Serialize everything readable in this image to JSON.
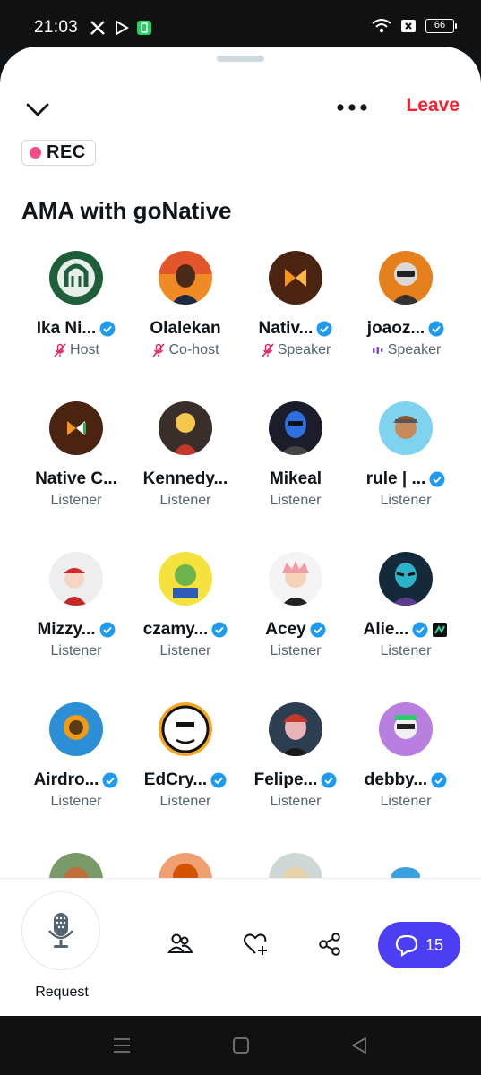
{
  "status_bar": {
    "time": "21:03",
    "battery": "66"
  },
  "header": {
    "leave_label": "Leave",
    "rec_label": "REC",
    "title": "AMA with goNative"
  },
  "colors": {
    "verified": "#1d9bf0",
    "leave": "#f4212e",
    "muted_role": "#e0245e",
    "accent": "#4b3ef3",
    "speaking": "#794bc4"
  },
  "participants": [
    {
      "name": "Ika Ni...",
      "role": "Host",
      "verified": true,
      "role_icon": "mic-off-icon"
    },
    {
      "name": "Olalekan",
      "role": "Co-host",
      "verified": false,
      "role_icon": "mic-off-icon"
    },
    {
      "name": "Nativ...",
      "role": "Speaker",
      "verified": true,
      "role_icon": "mic-off-icon"
    },
    {
      "name": "joaoz...",
      "role": "Speaker",
      "verified": true,
      "role_icon": "speaking-bars-icon"
    },
    {
      "name": "Native C...",
      "role": "Listener",
      "verified": false
    },
    {
      "name": "Kennedy...",
      "role": "Listener",
      "verified": false
    },
    {
      "name": "Mikeal",
      "role": "Listener",
      "verified": false
    },
    {
      "name": "rule | ...",
      "role": "Listener",
      "verified": true
    },
    {
      "name": "Mizzy...",
      "role": "Listener",
      "verified": true
    },
    {
      "name": "czamy...",
      "role": "Listener",
      "verified": true
    },
    {
      "name": "Acey",
      "role": "Listener",
      "verified": true
    },
    {
      "name": "Alie...",
      "role": "Listener",
      "verified": true,
      "affiliate_badge": true
    },
    {
      "name": "Airdro...",
      "role": "Listener",
      "verified": true
    },
    {
      "name": "EdCry...",
      "role": "Listener",
      "verified": true
    },
    {
      "name": "Felipe...",
      "role": "Listener",
      "verified": true
    },
    {
      "name": "debby...",
      "role": "Listener",
      "verified": true
    }
  ],
  "bottom_bar": {
    "request_label": "Request",
    "comments_count": "15"
  }
}
